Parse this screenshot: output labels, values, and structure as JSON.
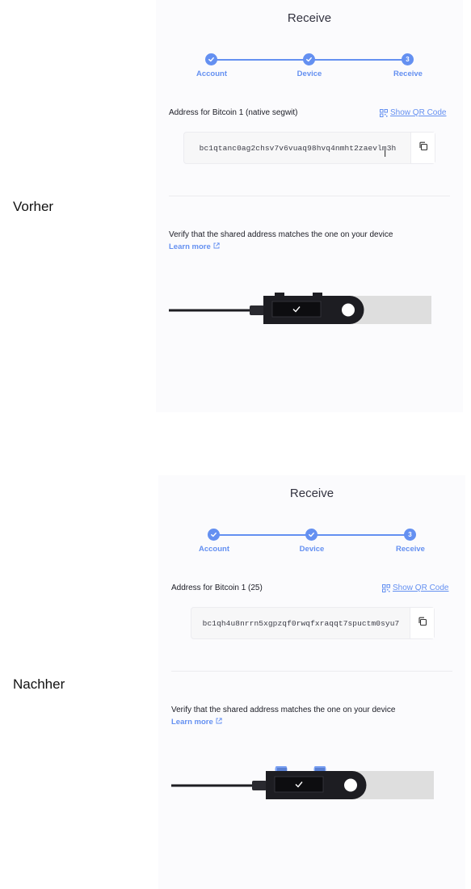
{
  "labels": {
    "before": "Vorher",
    "after": "Nachher"
  },
  "colors": {
    "accent": "#6490f1",
    "panel_bg": "#fbfbfd",
    "device_body": "#1d1d22",
    "device_cap": "#dedede"
  },
  "panels": [
    {
      "title": "Receive",
      "steps": [
        {
          "label": "Account",
          "state": "done"
        },
        {
          "label": "Device",
          "state": "done"
        },
        {
          "label": "Receive",
          "state": "current",
          "number": "3"
        }
      ],
      "address_label": "Address for Bitcoin 1 (native segwit)",
      "qr_link": "Show QR Code",
      "address": "bc1qtanc0ag2chsv7v6vuaq98hvq4nmht2zaevlm3h",
      "verify_text": "Verify that the shared address matches the one on your device",
      "learn_more": "Learn more",
      "device_buttons_highlighted": false,
      "icons": [
        "check-icon",
        "qr-code-icon",
        "copy-icon",
        "external-link-icon",
        "text-cursor-icon"
      ]
    },
    {
      "title": "Receive",
      "steps": [
        {
          "label": "Account",
          "state": "done"
        },
        {
          "label": "Device",
          "state": "done"
        },
        {
          "label": "Receive",
          "state": "current",
          "number": "3"
        }
      ],
      "address_label": "Address for Bitcoin 1 (25)",
      "qr_link": "Show QR Code",
      "address": "bc1qh4u8nrrn5xgpzqf0rwqfxraqqt7spuctm0syu7",
      "verify_text": "Verify that the shared address matches the one on your device",
      "learn_more": "Learn more",
      "device_buttons_highlighted": true,
      "icons": [
        "check-icon",
        "qr-code-icon",
        "copy-icon",
        "external-link-icon"
      ]
    }
  ]
}
